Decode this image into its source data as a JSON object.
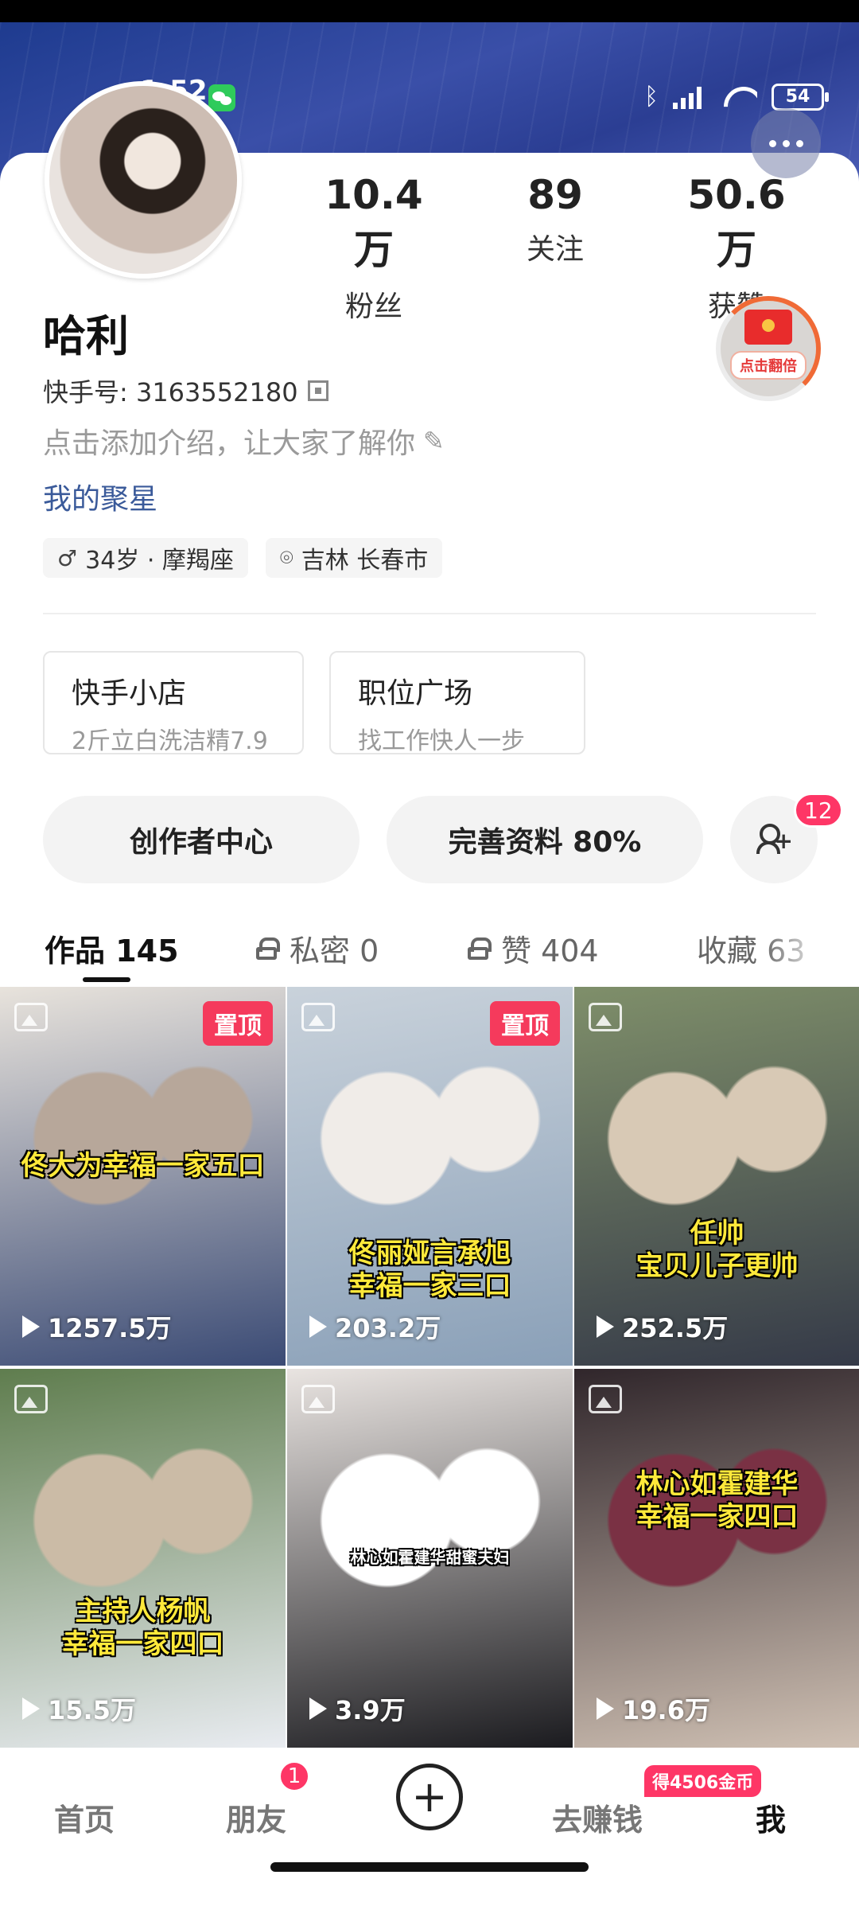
{
  "status_bar": {
    "time": "1:52",
    "battery": "54"
  },
  "profile": {
    "name": "哈利",
    "kwai_id": "快手号: 3163552180",
    "intro_placeholder": "点击添加介绍，让大家了解你",
    "star_link": "我的聚星",
    "age_sign": "34岁 · 摩羯座",
    "location": "吉林 长春市",
    "stats": [
      {
        "value": "10.4万",
        "label": "粉丝"
      },
      {
        "value": "89",
        "label": "关注"
      },
      {
        "value": "50.6万",
        "label": "获赞"
      }
    ],
    "redpacket_label": "点击翻倍"
  },
  "shop_cards": [
    {
      "title": "快手小店",
      "subtitle": "2斤立白洗洁精7.9"
    },
    {
      "title": "职位广场",
      "subtitle": "找工作快人一步"
    }
  ],
  "actions": {
    "creator_center": "创作者中心",
    "complete_profile": "完善资料 80%",
    "friend_requests_badge": "12"
  },
  "tabs": [
    {
      "label": "作品 145",
      "locked": false,
      "active": true
    },
    {
      "label": "私密 0",
      "locked": true,
      "active": false
    },
    {
      "label": "赞 404",
      "locked": true,
      "active": false
    },
    {
      "label": "收藏 63",
      "locked": false,
      "active": false
    }
  ],
  "works": [
    {
      "caption": "佟大为幸福一家五口",
      "plays": "1257.5万",
      "pinned": "置顶",
      "colors": [
        "#e8e3dc",
        "#b7a79a",
        "#3b4b75"
      ]
    },
    {
      "caption": "佟丽娅言承旭\n幸福一家三口",
      "plays": "203.2万",
      "pinned": "置顶",
      "colors": [
        "#c9d2db",
        "#f0ece8",
        "#8aa0b8"
      ]
    },
    {
      "caption": "任帅\n宝贝儿子更帅",
      "plays": "252.5万",
      "pinned": "",
      "colors": [
        "#7f8f6a",
        "#d8c9b5",
        "#353a48"
      ]
    },
    {
      "caption": "主持人杨帆\n幸福一家四口",
      "plays": "15.5万",
      "pinned": "",
      "colors": [
        "#5f7d4e",
        "#cbbba6",
        "#e9ecf1"
      ]
    },
    {
      "caption": "林心如霍建华甜蜜夫妇",
      "plays": "3.9万",
      "pinned": "",
      "colors": [
        "#e9e4e1",
        "#ffffff",
        "#1b1b1f"
      ]
    },
    {
      "caption": "林心如霍建华\n幸福一家四口",
      "plays": "19.6万",
      "pinned": "",
      "colors": [
        "#30262b",
        "#7a3144",
        "#cfc0b3"
      ]
    }
  ],
  "bottom_nav": {
    "home": "首页",
    "friends": "朋友",
    "friends_badge": "1",
    "earn": "去赚钱",
    "earn_badge": "得4506金币",
    "me": "我"
  }
}
